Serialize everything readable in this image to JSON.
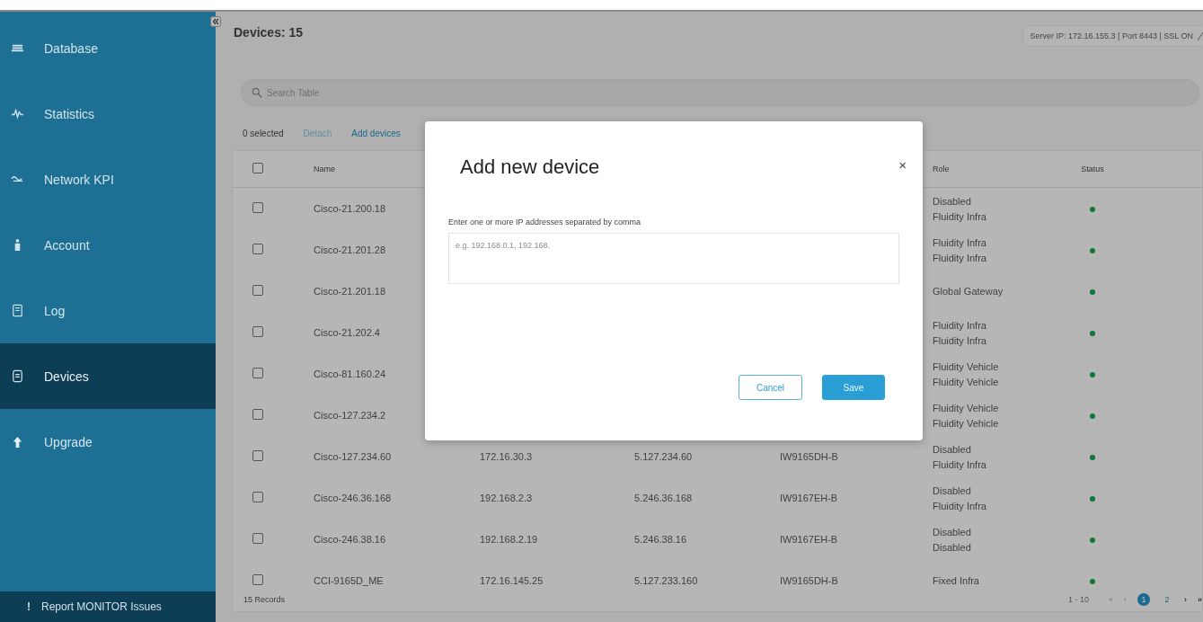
{
  "sidebar": {
    "items": [
      {
        "label": "Database",
        "selected": false
      },
      {
        "label": "Statistics",
        "selected": false
      },
      {
        "label": "Network KPI",
        "selected": false
      },
      {
        "label": "Account",
        "selected": false
      },
      {
        "label": "Log",
        "selected": false
      },
      {
        "label": "Devices",
        "selected": true
      },
      {
        "label": "Upgrade",
        "selected": false
      }
    ],
    "footer": {
      "mark": "!",
      "label": "Report MONITOR Issues"
    }
  },
  "header": {
    "title": "Devices: 15",
    "server_info": "Server IP: 172.16.155.3 | Port 8443 | SSL ON"
  },
  "search": {
    "placeholder": "Search Table"
  },
  "toolbar": {
    "selected_count": "0 selected",
    "actions": [
      {
        "label": "Detach",
        "disabled": true
      },
      {
        "label": "Add devices",
        "disabled": false
      }
    ]
  },
  "table": {
    "header_checked": false,
    "columns": [
      {
        "label": "Name"
      },
      {},
      {},
      {},
      {
        "label": "Role"
      },
      {
        "label": "Status"
      }
    ],
    "rows": [
      {
        "checked": false,
        "name": "Cisco-21.200.18",
        "role": [
          "Disabled",
          "Fluidity Infra"
        ],
        "online": true
      },
      {
        "checked": false,
        "name": "Cisco-21.201.28",
        "role": [
          "Fluidity Infra",
          "Fluidity Infra"
        ],
        "online": true
      },
      {
        "checked": false,
        "name": "Cisco-21.201.18",
        "role": [
          "Global Gateway"
        ],
        "online": true
      },
      {
        "checked": false,
        "name": "Cisco-21.202.4",
        "role": [
          "Fluidity Infra",
          "Fluidity Infra"
        ],
        "online": true
      },
      {
        "checked": false,
        "name": "Cisco-81.160.24",
        "role": [
          "Fluidity Vehicle",
          "Fluidity Vehicle"
        ],
        "online": true
      },
      {
        "checked": false,
        "name": "Cisco-127.234.2",
        "role": [
          "Fluidity Vehicle",
          "Fluidity Vehicle"
        ],
        "online": true
      },
      {
        "checked": false,
        "name": "Cisco-127.234.60",
        "column_3": "172.16.30.3",
        "column_4": "5.127.234.60",
        "column_5": "IW9165DH-B",
        "role": [
          "Disabled",
          "Fluidity Infra"
        ],
        "online": true
      },
      {
        "checked": false,
        "name": "Cisco-246.36.168",
        "column_3": "192.168.2.3",
        "column_4": "5.246.36.168",
        "column_5": "IW9167EH-B",
        "role": [
          "Disabled",
          "Fluidity Infra"
        ],
        "online": true
      },
      {
        "checked": false,
        "name": "Cisco-246.38.16",
        "column_3": "192.168.2.19",
        "column_4": "5.246.38.16",
        "column_5": "IW9167EH-B",
        "role": [
          "Disabled",
          "Disabled"
        ],
        "online": true
      },
      {
        "checked": false,
        "name": "CCI-9165D_ME",
        "column_3": "172.16.145.25",
        "column_4": "5.127.233.160",
        "column_5": "IW9165DH-B",
        "role": [
          "Fixed Infra"
        ],
        "online": true
      }
    ],
    "records": "15 Records"
  },
  "pagination": {
    "range": "1 - 10",
    "first": "«",
    "prev": "‹",
    "pages": [
      {
        "label": "1",
        "selected": true
      },
      {
        "label": "2",
        "selected": false
      }
    ],
    "next": "›",
    "last": "»"
  },
  "dialog": {
    "title": "Add new device",
    "close": "×",
    "label": "Enter one or more IP addresses separated by comma",
    "placeholder": "e.g. 192.168.0.1, 192.168.",
    "buttons": [
      {
        "label": "Cancel",
        "kind": "secondary"
      },
      {
        "label": "Save",
        "kind": "primary"
      }
    ]
  }
}
